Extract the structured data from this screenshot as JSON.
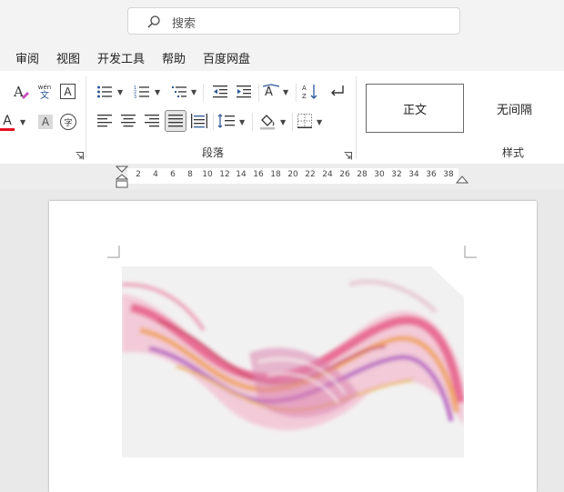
{
  "search": {
    "placeholder": "搜索"
  },
  "menu": [
    "审阅",
    "视图",
    "开发工具",
    "帮助",
    "百度网盘"
  ],
  "font_tools": {
    "phonetic_top": "wén",
    "phonetic_bottom": "文",
    "font_color_letter": "A",
    "char_shading_letter": "A",
    "enclose_char": "字",
    "char_border_letter": "A"
  },
  "groups": {
    "paragraph": "段落",
    "styles": "样式"
  },
  "styles": [
    "正文",
    "无间隔"
  ],
  "ruler": [
    "2",
    "4",
    "6",
    "8",
    "10",
    "12",
    "14",
    "16",
    "18",
    "20",
    "22",
    "24",
    "26",
    "28",
    "30",
    "32",
    "34",
    "36",
    "38"
  ],
  "colors": {
    "font_color_bar": "#e81123",
    "accent_blue": "#2b5797",
    "highlight_fill": "#e6e6e6"
  }
}
